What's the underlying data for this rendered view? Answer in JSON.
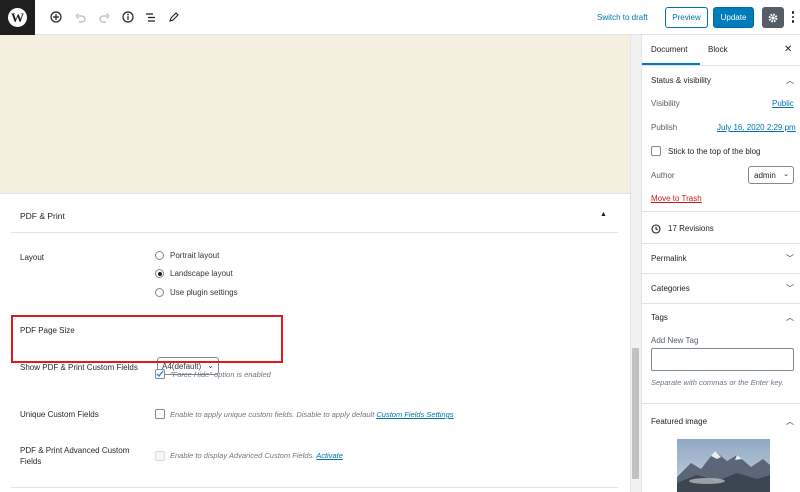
{
  "toolbar": {
    "logo_letter": "W",
    "switch_to_draft": "Switch to draft",
    "preview_label": "Preview",
    "update_label": "Update"
  },
  "metabox": {
    "title": "PDF & Print",
    "layout": {
      "label": "Layout",
      "options": [
        "Portrait layout",
        "Landscape layout",
        "Use plugin settings"
      ],
      "selected": "Landscape layout"
    },
    "page_size": {
      "label": "PDF Page Size",
      "value": "A4(default)"
    },
    "show_custom_fields": {
      "label": "Show PDF & Print Custom Fields",
      "checked": true,
      "hint": "\"Force Hide\" option is enabled"
    },
    "unique_custom_fields": {
      "label": "Unique Custom Fields",
      "checked": false,
      "hint": "Enable to apply unique custom fields. Disable to apply default",
      "link": "Custom Fields Settings"
    },
    "advanced_custom_fields": {
      "label": "PDF & Print Advanced Custom Fields",
      "checked": false,
      "disabled": true,
      "hint": "Enable to display Advanced Custom Fields.",
      "link": "Activate"
    }
  },
  "sidebar": {
    "tabs": [
      "Document",
      "Block"
    ],
    "active_tab": "Document",
    "status": {
      "title": "Status & visibility",
      "visibility_label": "Visibility",
      "visibility_value": "Public",
      "publish_label": "Publish",
      "publish_value": "July 16, 2020 2:29 pm",
      "sticky_label": "Stick to the top of the blog",
      "author_label": "Author",
      "author_value": "admin",
      "trash_label": "Move to Trash"
    },
    "revisions": "17 Revisions",
    "permalink": "Permalink",
    "categories": "Categories",
    "tags": {
      "title": "Tags",
      "add_label": "Add New Tag",
      "help": "Separate with commas or the Enter key."
    },
    "featured_image": "Featured image"
  },
  "colors": {
    "accent": "#007cba",
    "link": "#0073aa",
    "canvas": "#f5efe0",
    "highlight": "#e01b1b",
    "danger": "#cc1818"
  }
}
